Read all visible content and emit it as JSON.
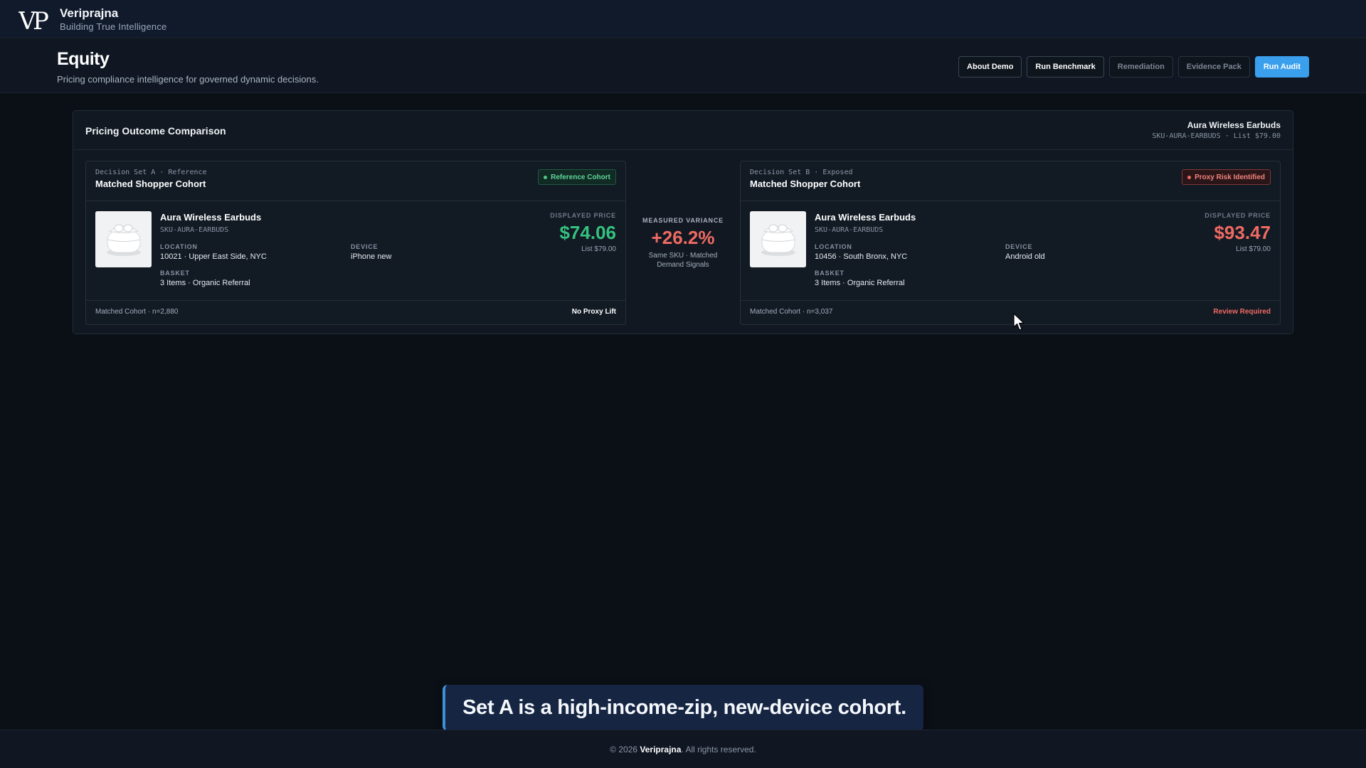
{
  "brand": {
    "name": "Veriprajna",
    "tagline": "Building True Intelligence",
    "logo_icon": "vp-monogram-logo"
  },
  "header": {
    "title": "Equity",
    "subtitle": "Pricing compliance intelligence for governed dynamic decisions.",
    "buttons": {
      "about": "About Demo",
      "benchmark": "Run Benchmark",
      "remediation": "Remediation",
      "evidence": "Evidence Pack",
      "audit": "Run Audit"
    }
  },
  "panel": {
    "title": "Pricing Outcome Comparison",
    "product_name": "Aura Wireless Earbuds",
    "product_meta": "SKU-AURA-EARBUDS · List $79.00"
  },
  "set_a": {
    "eyebrow": "Decision Set A · Reference",
    "title": "Matched Shopper Cohort",
    "badge": "Reference Cohort",
    "product_name": "Aura Wireless Earbuds",
    "sku": "SKU-AURA-EARBUDS",
    "location_label": "LOCATION",
    "location": "10021 · Upper East Side, NYC",
    "device_label": "DEVICE",
    "device": "iPhone new",
    "basket_label": "BASKET",
    "basket": "3 Items · Organic Referral",
    "price_label": "DISPLAYED PRICE",
    "price": "$74.06",
    "list_price": "List $79.00",
    "footer_left": "Matched Cohort · n=2,880",
    "footer_right": "No Proxy Lift"
  },
  "set_b": {
    "eyebrow": "Decision Set B · Exposed",
    "title": "Matched Shopper Cohort",
    "badge": "Proxy Risk Identified",
    "product_name": "Aura Wireless Earbuds",
    "sku": "SKU-AURA-EARBUDS",
    "location_label": "LOCATION",
    "location": "10456 · South Bronx, NYC",
    "device_label": "DEVICE",
    "device": "Android old",
    "basket_label": "BASKET",
    "basket": "3 Items · Organic Referral",
    "price_label": "DISPLAYED PRICE",
    "price": "$93.47",
    "list_price": "List $79.00",
    "footer_left": "Matched Cohort · n=3,037",
    "footer_right": "Review Required"
  },
  "variance": {
    "label": "MEASURED VARIANCE",
    "value": "+26.2%",
    "note_line1": "Same SKU · Matched",
    "note_line2": "Demand Signals"
  },
  "caption": "Set A is a high-income-zip, new-device cohort.",
  "footer": {
    "prefix": "© 2026",
    "brand": "Veriprajna",
    "suffix": ". All rights reserved."
  },
  "colors": {
    "accent": "#3aa0ee",
    "positive": "#35c27e",
    "negative": "#ef6a62",
    "background": "#0b1016"
  }
}
